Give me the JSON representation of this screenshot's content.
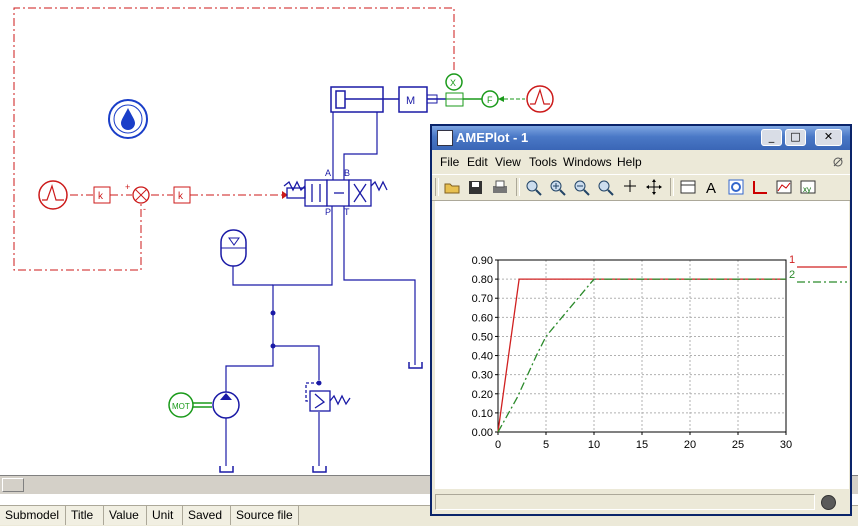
{
  "diagram": {
    "labels": {
      "port_a": "A",
      "port_b": "B",
      "port_p": "P",
      "port_t": "T",
      "mass": "M",
      "gain_1": "k",
      "gain_2": "k",
      "sum_plus": "+",
      "sum_minus": "-",
      "motor": "MOT",
      "force": "F",
      "sensor": "X"
    },
    "colors": {
      "hydraulic": "#1a1aa6",
      "signal": "#cc1a1a",
      "mechanical": "#1a9a1a"
    }
  },
  "plot_window": {
    "title": "AMEPlot - 1",
    "controls": {
      "minimize": "_",
      "maximize": "□",
      "close": "✕"
    },
    "menus": [
      "File",
      "Edit",
      "View",
      "Tools",
      "Windows",
      "Help"
    ],
    "toolbar_icons": [
      "open-icon",
      "save-icon",
      "print-icon",
      "zoom-fit-icon",
      "zoom-in-icon",
      "zoom-out-icon",
      "zoom-box-icon",
      "crosshair-icon",
      "pan-icon",
      "layout-icon",
      "text-icon",
      "refresh-icon",
      "axis-icon",
      "legend-icon",
      "xy-icon"
    ]
  },
  "chart_data": {
    "type": "line",
    "xlim": [
      0,
      30
    ],
    "ylim": [
      0,
      0.9
    ],
    "x_ticks": [
      "0",
      "5",
      "10",
      "15",
      "20",
      "25",
      "30"
    ],
    "y_ticks": [
      "0.00",
      "0.10",
      "0.20",
      "0.30",
      "0.40",
      "0.50",
      "0.60",
      "0.70",
      "0.80",
      "0.90"
    ],
    "grid": true,
    "legend_position": "right",
    "series": [
      {
        "name": "1",
        "color": "#d02020",
        "dash": "solid",
        "x": [
          0,
          2.2,
          30
        ],
        "y": [
          0,
          0.8,
          0.8
        ]
      },
      {
        "name": "2",
        "color": "#2a8a2a",
        "dash": "dashdot",
        "x": [
          0,
          2,
          4,
          5,
          7,
          9,
          10,
          30
        ],
        "y": [
          0,
          0.18,
          0.4,
          0.5,
          0.62,
          0.74,
          0.8,
          0.8
        ]
      }
    ]
  },
  "status_table": {
    "columns": [
      "Submodel",
      "Title",
      "Value",
      "Unit",
      "Saved",
      "Source file"
    ]
  }
}
